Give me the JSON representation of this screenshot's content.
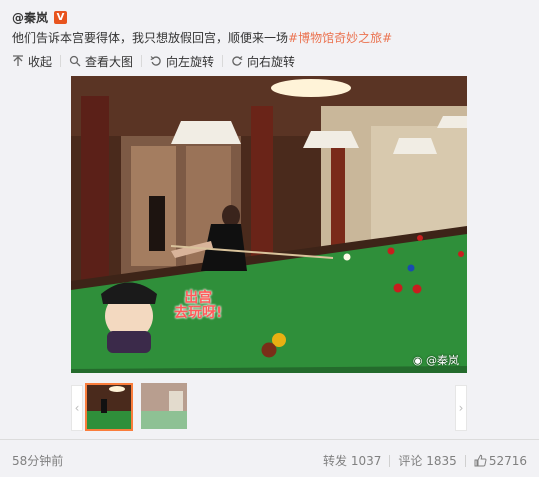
{
  "post": {
    "author": "@秦岚",
    "vip_badge": "V",
    "text_main": "他们告诉本宫要得体，我只想放假回宫，顺便来一场",
    "text_tag": "#博物馆奇妙之旅#"
  },
  "toolbar": {
    "collapse": "收起",
    "view_large": "查看大图",
    "rotate_left": "向左旋转",
    "rotate_right": "向右旋转"
  },
  "photo": {
    "sticker_line1": "出宫",
    "sticker_line2": "去玩呀!",
    "watermark": "@秦岚"
  },
  "thumbnails": {
    "prev_arrow": "‹",
    "next_arrow": "›"
  },
  "footer": {
    "time": "58分钟前",
    "repost_label": "转发",
    "repost_count": "1037",
    "comment_label": "评论",
    "comment_count": "1835",
    "like_count": "52716"
  },
  "colors": {
    "accent": "#eb7350",
    "thumb_selected": "#fa7d3c",
    "table_green": "#2f8f3a"
  },
  "icons": [
    "collapse-icon",
    "magnify-icon",
    "rotate-left-icon",
    "rotate-right-icon",
    "like-icon",
    "weibo-logo-icon"
  ]
}
